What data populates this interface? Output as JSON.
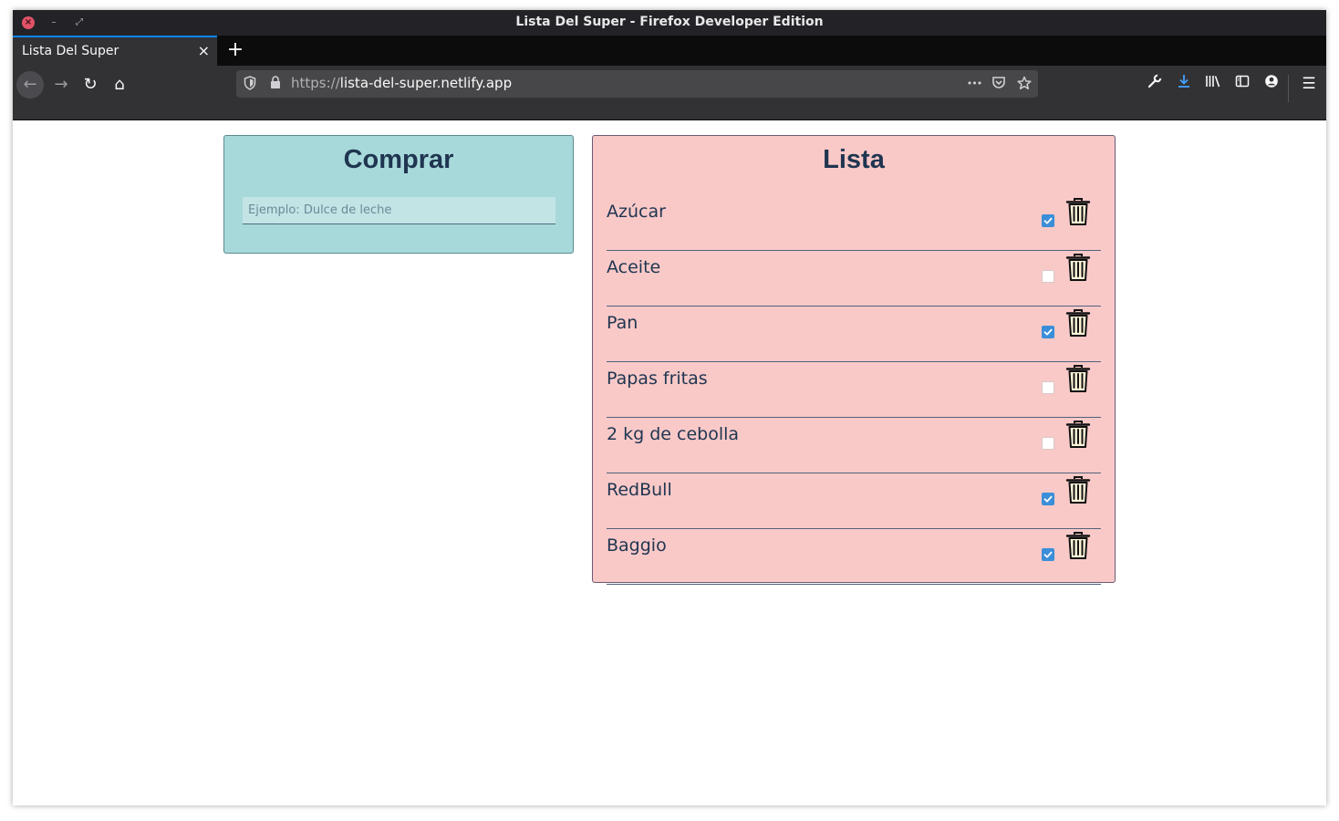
{
  "window": {
    "title": "Lista Del Super - Firefox Developer Edition",
    "controls": {
      "close": "×",
      "minimize": "–",
      "maximize": "⤢"
    }
  },
  "tabs": [
    {
      "label": "Lista Del Super",
      "close": "×"
    }
  ],
  "newtab_label": "+",
  "navbar": {
    "back": "←",
    "forward": "→",
    "reload": "↻",
    "home": "⌂",
    "url_protocol": "https://",
    "url_host": "lista-del-super.netlify.app",
    "page_actions": "•••",
    "menu": "☰"
  },
  "comprar": {
    "title": "Comprar",
    "input_placeholder": "Ejemplo: Dulce de leche",
    "input_value": ""
  },
  "lista": {
    "title": "Lista",
    "items": [
      {
        "label": "Azúcar",
        "checked": true
      },
      {
        "label": "Aceite",
        "checked": false
      },
      {
        "label": "Pan",
        "checked": true
      },
      {
        "label": "Papas fritas",
        "checked": false
      },
      {
        "label": "2 kg de cebolla",
        "checked": false
      },
      {
        "label": "RedBull",
        "checked": true
      },
      {
        "label": "Baggio",
        "checked": true
      }
    ]
  },
  "colors": {
    "comprar_bg": "#a8d9da",
    "lista_bg": "#f9c9c8",
    "heading": "#1f3550",
    "checkbox_checked": "#3b8ed8",
    "accent": "#0a84ff"
  },
  "icons": {
    "back": "arrow-left-icon",
    "forward": "arrow-right-icon",
    "reload": "reload-icon",
    "home": "home-icon",
    "shield": "tracking-shield-icon",
    "lock": "lock-icon",
    "pocket": "pocket-icon",
    "star": "bookmark-star-icon",
    "wrench": "developer-wrench-icon",
    "download": "download-icon",
    "library": "library-icon",
    "sidebar": "sidebar-icon",
    "account": "account-icon",
    "trash": "trash-icon"
  }
}
